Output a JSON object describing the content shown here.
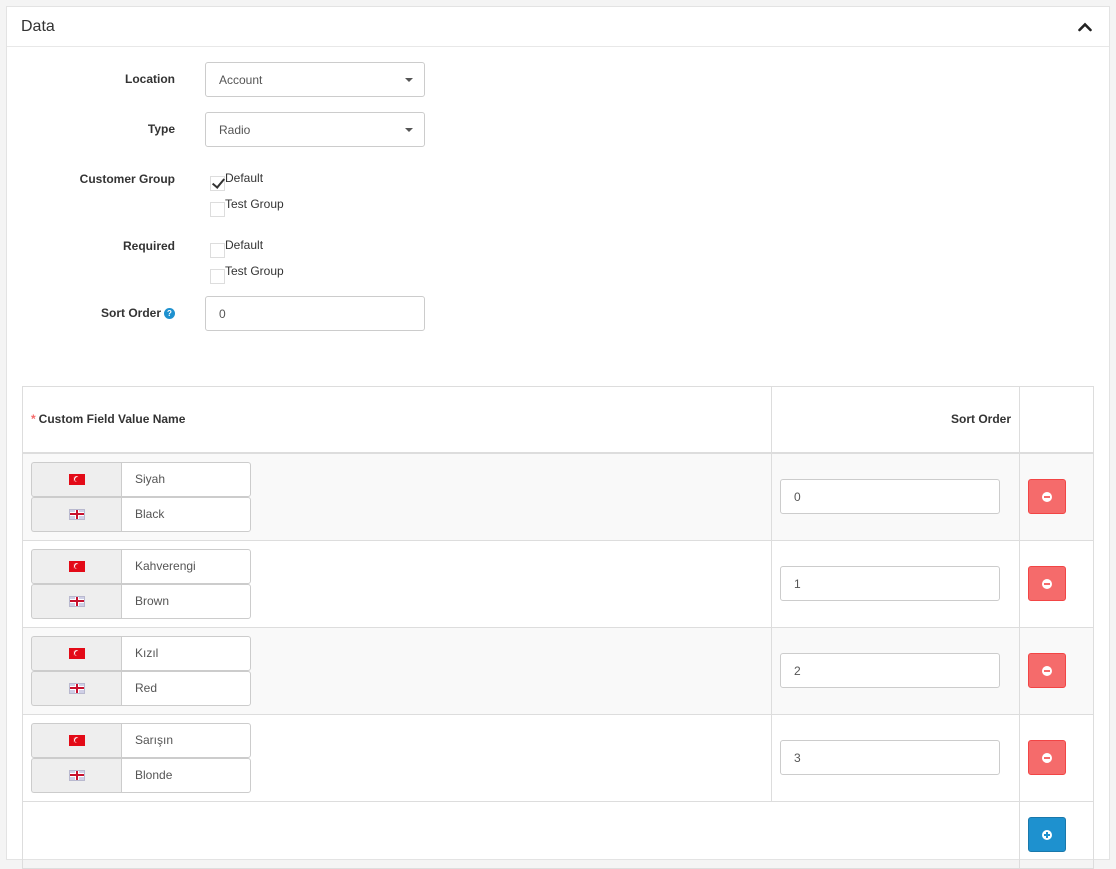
{
  "panel": {
    "title": "Data"
  },
  "form": {
    "location": {
      "label": "Location",
      "value": "Account"
    },
    "type": {
      "label": "Type",
      "value": "Radio"
    },
    "customer_group": {
      "label": "Customer Group",
      "options": [
        {
          "label": "Default",
          "checked": true
        },
        {
          "label": "Test Group",
          "checked": false
        }
      ]
    },
    "required": {
      "label": "Required",
      "options": [
        {
          "label": "Default",
          "checked": false
        },
        {
          "label": "Test Group",
          "checked": false
        }
      ]
    },
    "sort_order": {
      "label": "Sort Order",
      "value": "0"
    }
  },
  "table": {
    "required_mark": "*",
    "col_name": "Custom Field Value Name",
    "col_sort": "Sort Order",
    "rows": [
      {
        "tr": "Siyah",
        "en": "Black",
        "sort": "0"
      },
      {
        "tr": "Kahverengi",
        "en": "Brown",
        "sort": "1"
      },
      {
        "tr": "Kızıl",
        "en": "Red",
        "sort": "2"
      },
      {
        "tr": "Sarışın",
        "en": "Blonde",
        "sort": "3"
      }
    ]
  },
  "colors": {
    "danger": "#f56b6b",
    "primary": "#1e91cf"
  },
  "icons": {
    "collapse": "chevron-up-icon",
    "help": "question-circle-icon",
    "remove": "minus-circle-icon",
    "add": "plus-circle-icon",
    "flag_tr": "turkey-flag-icon",
    "flag_en": "uk-flag-icon"
  }
}
